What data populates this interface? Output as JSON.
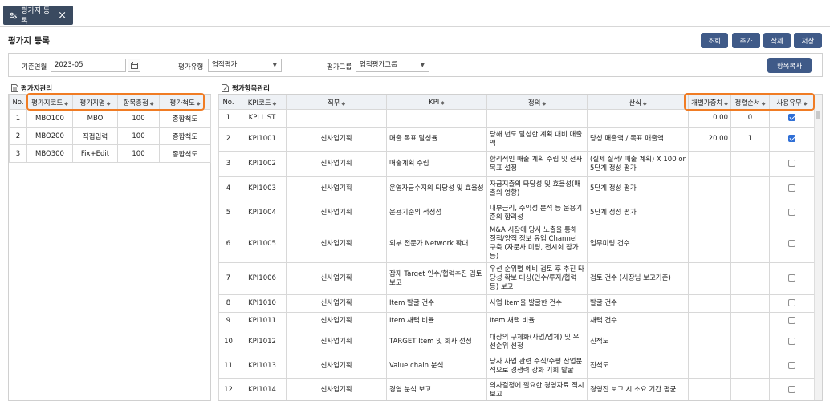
{
  "tab": {
    "label": "평가지 등록",
    "icon": "sliders-icon"
  },
  "page_title": "평가지 등록",
  "toolbar": {
    "search": "조회",
    "add": "추가",
    "delete": "삭제",
    "save": "저장",
    "copy_items": "항목복사"
  },
  "filters": {
    "date_label": "기준연월",
    "date_value": "2023-05",
    "type_label": "평가유형",
    "type_value": "업적평가",
    "group_label": "평가그룹",
    "group_value": "업적평가그룹"
  },
  "left": {
    "title": "평가지관리",
    "columns": [
      "No.",
      "평가지코드",
      "평가지명",
      "항목총점",
      "평가척도"
    ],
    "rows": [
      {
        "no": "1",
        "code": "MBO100",
        "name": "MBO",
        "total": "100",
        "scale": "종합척도"
      },
      {
        "no": "2",
        "code": "MBO200",
        "name": "직접입력",
        "total": "100",
        "scale": "종합척도"
      },
      {
        "no": "3",
        "code": "MBO300",
        "name": "Fix+Edit",
        "total": "100",
        "scale": "종합척도"
      }
    ]
  },
  "right": {
    "title": "평가항목관리",
    "columns": [
      "No.",
      "KPI코드",
      "직무",
      "KPI",
      "정의",
      "산식",
      "개별가중치",
      "정렬순서",
      "사용유무"
    ],
    "rows": [
      {
        "no": "1",
        "code": "KPI LIST",
        "job": "",
        "kpi": "",
        "def": "",
        "formula": "",
        "weight": "0.00",
        "order": "0",
        "use": true
      },
      {
        "no": "2",
        "code": "KPI1001",
        "job": "신사업기획",
        "kpi": "매출 목표 달성율",
        "def": "당해 년도 달성한 계획 대비 매출액",
        "formula": "당성 매출액 / 목표 매출액",
        "weight": "20.00",
        "order": "1",
        "use": true
      },
      {
        "no": "3",
        "code": "KPI1002",
        "job": "신사업기획",
        "kpi": "매출계획 수립",
        "def": "합리적인 매출 계획 수립 및 전사 목표 설정",
        "formula": "(실제 실적/ 매출 계획) X 100 or 5단계 정성 평가",
        "weight": "",
        "order": "",
        "use": false
      },
      {
        "no": "4",
        "code": "KPI1003",
        "job": "신사업기획",
        "kpi": "운영자금수지의 타당성 및 효율성",
        "def": "자금지출의 타당성 및 효율성(매출의 영향)",
        "formula": "5단계 정성 평가",
        "weight": "",
        "order": "",
        "use": false
      },
      {
        "no": "5",
        "code": "KPI1004",
        "job": "신사업기획",
        "kpi": "운용기준의 적정성",
        "def": "내부금리, 수익성 분석 등 운용기준의 합리성",
        "formula": "5단계 정성 평가",
        "weight": "",
        "order": "",
        "use": false
      },
      {
        "no": "6",
        "code": "KPI1005",
        "job": "신사업기획",
        "kpi": "외부 전문가 Network 확대",
        "def": "M&A 시장에 당사 노출을 통해 질적/양적 정보 유입 Channel 구축 (자문사 미팅, 전시회 참가 등)",
        "formula": "업무미팅 건수",
        "weight": "",
        "order": "",
        "use": false
      },
      {
        "no": "7",
        "code": "KPI1006",
        "job": "신사업기획",
        "kpi": "잠재 Target 인수/협력추진 검토 보고",
        "def": "우선 순위별 예비 검토 후 추진 타당성 확보 대상(인수/투자/협력 등) 보고",
        "formula": "검토 건수 (사장님 보고기준)",
        "weight": "",
        "order": "",
        "use": false
      },
      {
        "no": "8",
        "code": "KPI1010",
        "job": "신사업기획",
        "kpi": "Item 발굴 건수",
        "def": "사업 Item을 발굴한 건수",
        "formula": "발굴 건수",
        "weight": "",
        "order": "",
        "use": false
      },
      {
        "no": "9",
        "code": "KPI1011",
        "job": "신사업기획",
        "kpi": "Item 채택 비율",
        "def": "Item 채택 비율",
        "formula": "채택 건수",
        "weight": "",
        "order": "",
        "use": false
      },
      {
        "no": "10",
        "code": "KPI1012",
        "job": "신사업기획",
        "kpi": "TARGET Item 및 회사 선정",
        "def": "대상의 구체화(사업/업체) 및 우선순위 선정",
        "formula": "진척도",
        "weight": "",
        "order": "",
        "use": false
      },
      {
        "no": "11",
        "code": "KPI1013",
        "job": "신사업기획",
        "kpi": "Value chain 분석",
        "def": "당사 사업 관련 수직/수평 산업분석으로 경쟁력 강화 기회 발굴",
        "formula": "진척도",
        "weight": "",
        "order": "",
        "use": false
      },
      {
        "no": "12",
        "code": "KPI1014",
        "job": "신사업기획",
        "kpi": "경영 분석 보고",
        "def": "의사결정에 필요한 경영자료 적시 보고",
        "formula": "경영진 보고 시 소요 기간 평균",
        "weight": "",
        "order": "",
        "use": false
      }
    ]
  },
  "colors": {
    "tab_bg": "#3a4a60",
    "button_bg": "#3f5a88",
    "highlight": "#f07c24",
    "header_bg": "#eef1f5",
    "check_blue": "#2f6fd6"
  }
}
